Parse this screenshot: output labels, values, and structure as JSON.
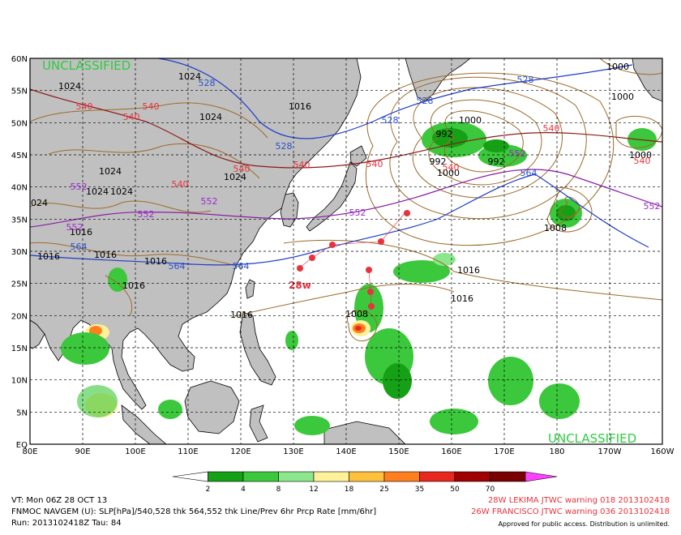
{
  "classification": {
    "top_left": "UNCLASSIFIED",
    "bottom_right": "UNCLASSIFIED"
  },
  "lat_labels": [
    "60N",
    "55N",
    "50N",
    "45N",
    "40N",
    "35N",
    "30N",
    "25N",
    "20N",
    "15N",
    "10N",
    "5N",
    "EQ"
  ],
  "lon_labels": [
    "80E",
    "90E",
    "100E",
    "110E",
    "120E",
    "130E",
    "140E",
    "150E",
    "160E",
    "170E",
    "180",
    "170W",
    "160W"
  ],
  "colorbar": {
    "labels": [
      "2",
      "4",
      "8",
      "12",
      "18",
      "25",
      "35",
      "50",
      "70"
    ],
    "colors": [
      "#ffffff",
      "#15a015",
      "#3cc83c",
      "#8ce68c",
      "#fff09a",
      "#ffc03c",
      "#ff7f1e",
      "#e8281e",
      "#a00000",
      "#7a0000",
      "#ff40ff"
    ]
  },
  "contour_labels": {
    "slp": [
      "1024",
      "1024",
      "1024",
      "1024",
      "1024",
      "1016",
      "1016",
      "1016",
      "1016",
      "1016",
      "1016",
      "1016",
      "1016",
      "1016",
      "992",
      "992",
      "992",
      "1000",
      "1000",
      "1000",
      "1000",
      "1000",
      "1008",
      "1008",
      "1024",
      "1024",
      "1024"
    ],
    "thk_540": [
      "540",
      "540",
      "540",
      "540",
      "540",
      "540",
      "540",
      "540",
      "540",
      "540"
    ],
    "thk_528": [
      "528",
      "528",
      "528",
      "528",
      "528"
    ],
    "thk_552": [
      "552",
      "552",
      "552",
      "552",
      "552",
      "552",
      "552"
    ],
    "thk_564": [
      "564",
      "564",
      "564",
      "564"
    ]
  },
  "storms": [
    {
      "name": "28W",
      "label": "28w",
      "lat": 27.5,
      "lon": 131.0,
      "color": "#e8323c"
    },
    {
      "name": "26W",
      "lat": 23.0,
      "lon": 144.5,
      "color": "#e8323c"
    }
  ],
  "footer": {
    "vt": "VT: Mon 06Z 28 OCT 13",
    "model": "FNMOC NAVGEM (U): SLP[hPa]/540,528 thk 564,552 thk Line/Prev 6hr Prcp Rate [mm/6hr]",
    "run": "Run: 2013102418Z Tau: 84",
    "warning_1": "28W LEKIMA JTWC warning 018 2013102418",
    "warning_2": "26W FRANCISCO JTWC warning 036 2013102418",
    "note": "Approved for public access. Distribution is unlimited."
  },
  "colors": {
    "land": "#c0c0c0",
    "slp_contour": "#9c6b2a",
    "thk_528": "#1e3cc8",
    "thk_540": "#8b1a1a",
    "thk_552": "#8a1ea8",
    "thk_564": "#1e3cc8",
    "label_red": "#e8323c",
    "label_blue": "#2850d0",
    "label_purple": "#9a2ad0"
  }
}
